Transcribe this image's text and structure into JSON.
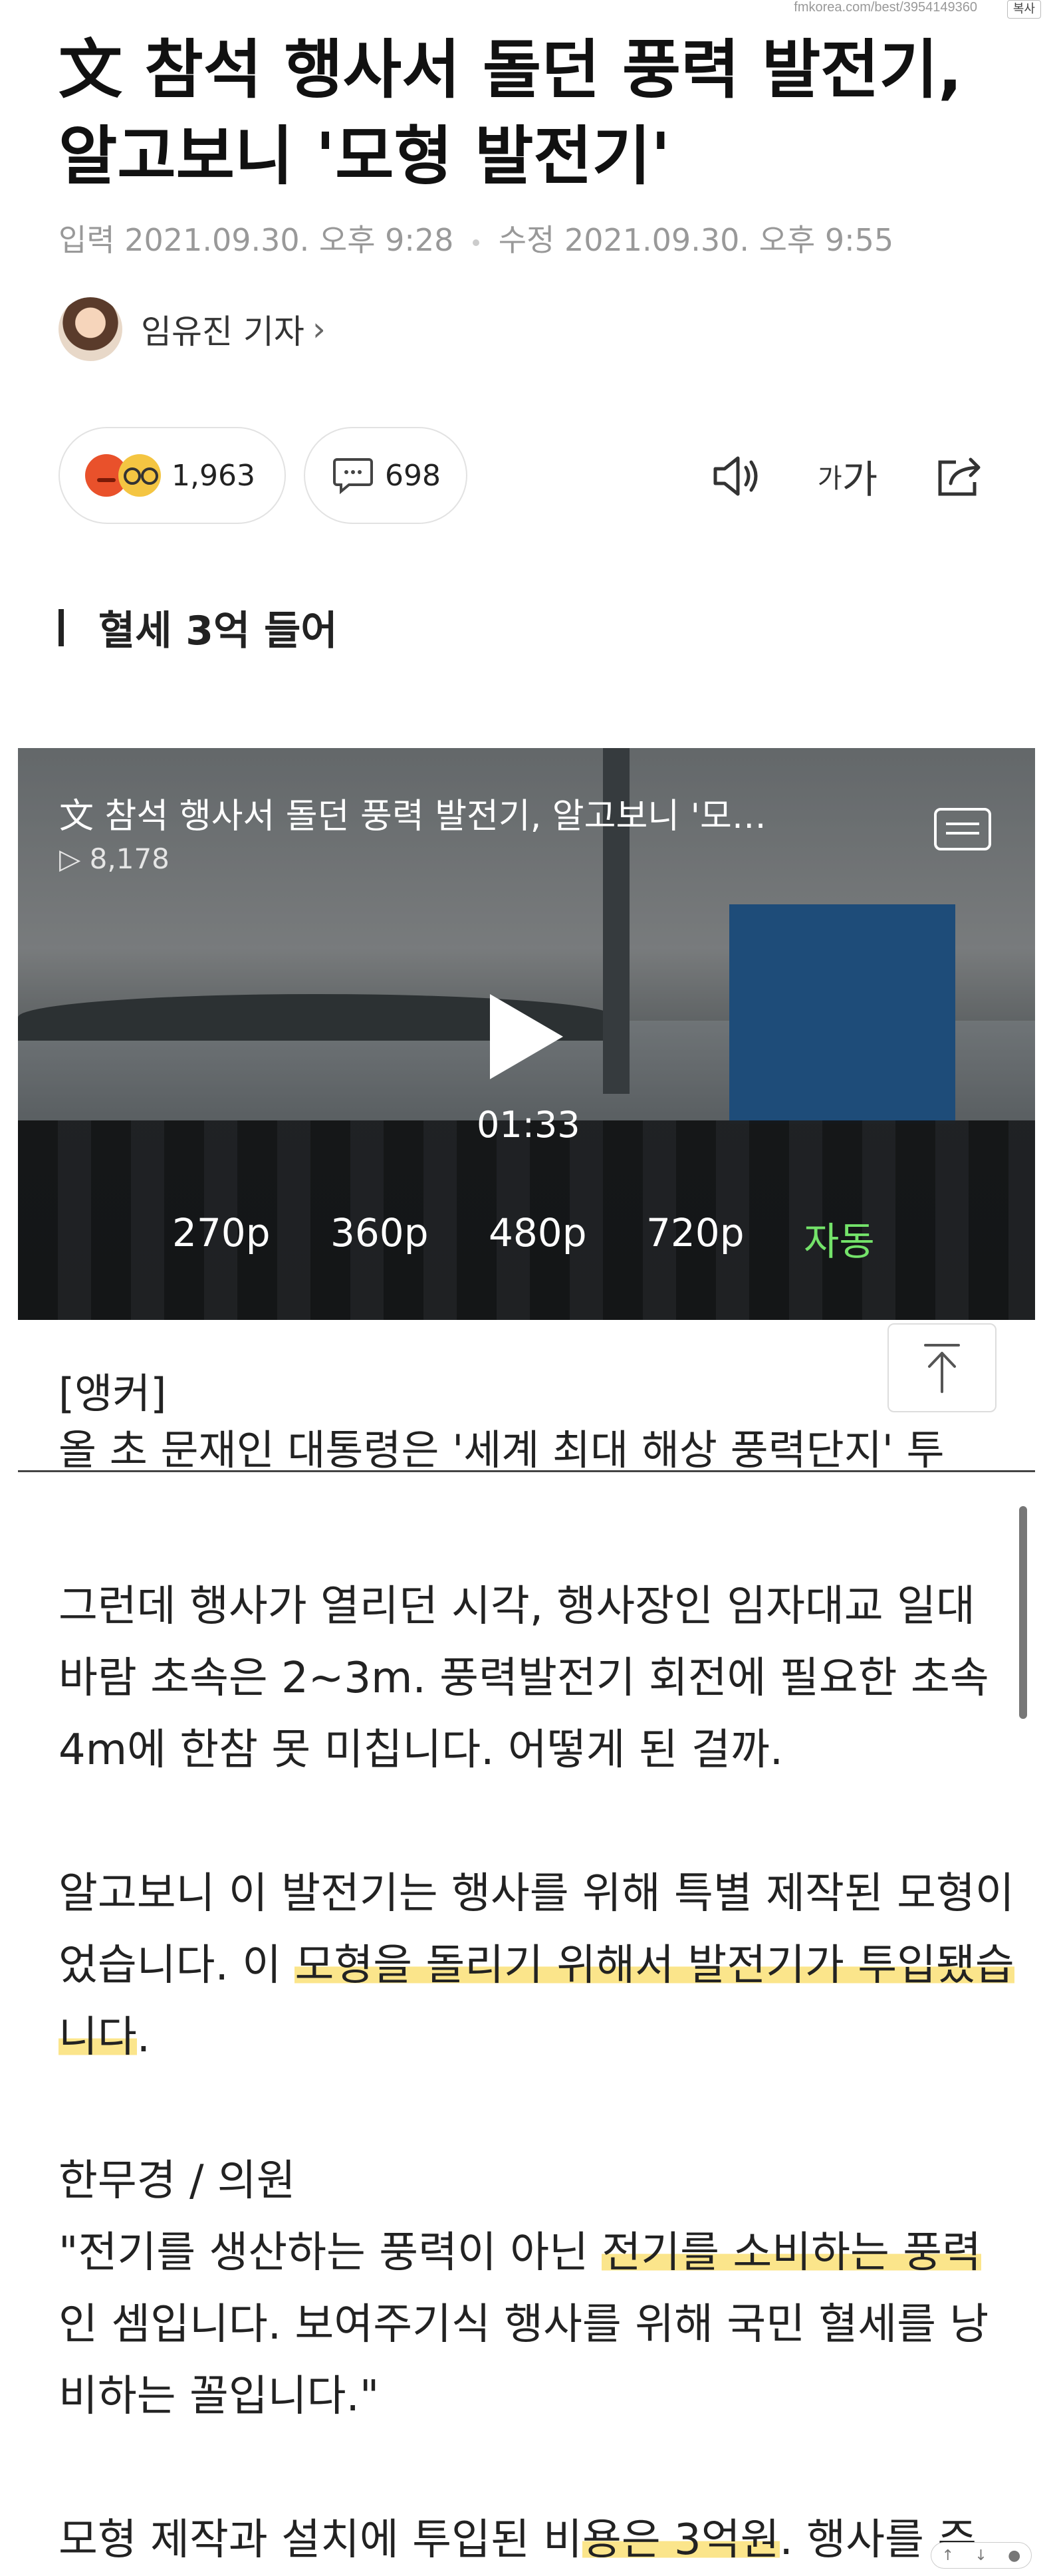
{
  "source": {
    "url": "fmkorea.com/best/3954149360",
    "copy_label": "복사"
  },
  "article": {
    "title": "文 참석 행사서 돌던 풍력 발전기, 알고보니 '모형 발전기'",
    "input_label": "입력",
    "input_time": "2021.09.30. 오후 9:28",
    "edit_label": "수정",
    "edit_time": "2021.09.30. 오후 9:55",
    "author": "임유진 기자",
    "reaction_count": "1,963",
    "comment_count": "698",
    "font_small": "가",
    "font_big": "가",
    "subheading": "혈세 3억 들어"
  },
  "video": {
    "title": "文 참석 행사서 돌던 풍력 발전기, 알고보니 '모…",
    "views": "▷ 8,178",
    "duration": "01:33",
    "qualities": [
      "270p",
      "360p",
      "480p",
      "720p",
      "자동"
    ],
    "active_quality": "자동"
  },
  "body": {
    "anchor": "[앵커]",
    "cut_line": "올 초 문재인 대통령은 '세계 최대 해상 풍력단지' 투",
    "p1": "그런데 행사가 열리던 시각, 행사장인 임자대교 일대 바람 초속은 2~3m. 풍력발전기 회전에 필요한 초속 4m에 한참 못 미칩니다. 어떻게 된 걸까.",
    "p2_a": "알고보니 이 발전기는 행사를 위해 특별 제작된 모형이었습니다. 이 ",
    "p2_hl": "모형을 돌리기 위해서 발전기가 투입됐습니다",
    "p2_b": ".",
    "p3_speaker": "한무경 / 의원",
    "p3_a": "\"전기를 생산하는 풍력이 아닌 ",
    "p3_hl": "전기를 소비하는 풍력",
    "p3_b": "인 셈입니다. 보여주기식 행사를 위해 국민 혈세를 낭비하는 꼴입니다.\"",
    "p4_a": "모형 제작과 설치에 투입된 비",
    "p4_hl": "용은 3억원",
    "p4_b": ". 행사를 주"
  },
  "icons": [
    "angry-emoji-icon",
    "glasses-emoji-icon",
    "comment-bubble-icon",
    "speaker-icon",
    "share-icon",
    "play-icon",
    "menu-icon",
    "arrow-up-icon"
  ]
}
